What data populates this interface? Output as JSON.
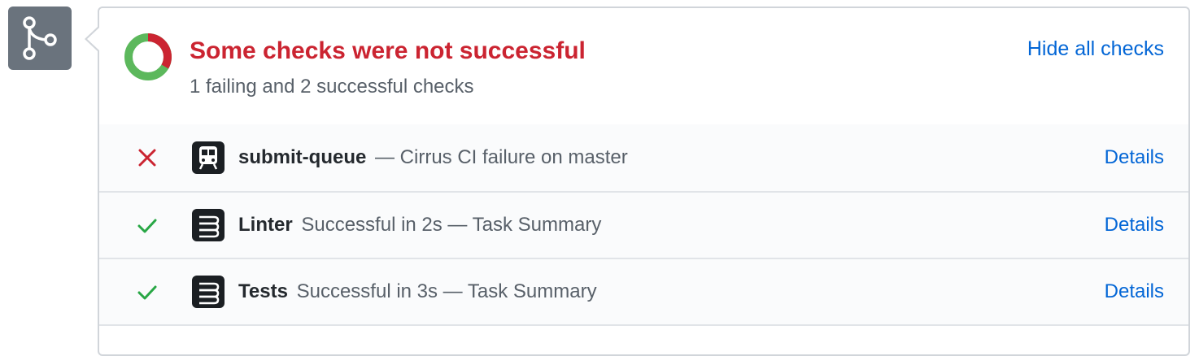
{
  "merge_icon": "git-merge-icon",
  "summary": {
    "title": "Some checks were not successful",
    "subtitle": "1 failing and 2 successful checks",
    "hide_link": "Hide all checks",
    "donut": {
      "failing": 1,
      "successful": 2,
      "fail_color": "#cb2431",
      "success_color": "#5cb85c"
    }
  },
  "checks": [
    {
      "status": "failure",
      "status_icon": "x-icon",
      "app_icon": "train-icon",
      "name": "submit-queue",
      "description": "— Cirrus CI failure on master",
      "details": "Details"
    },
    {
      "status": "success",
      "status_icon": "check-icon",
      "app_icon": "cirrus-ci-icon",
      "name": "Linter",
      "description": " Successful in 2s — Task Summary",
      "details": "Details"
    },
    {
      "status": "success",
      "status_icon": "check-icon",
      "app_icon": "cirrus-ci-icon",
      "name": "Tests",
      "description": " Successful in 3s — Task Summary",
      "details": "Details"
    }
  ],
  "colors": {
    "fail": "#cb2431",
    "success": "#28a745",
    "link": "#0366d6"
  }
}
